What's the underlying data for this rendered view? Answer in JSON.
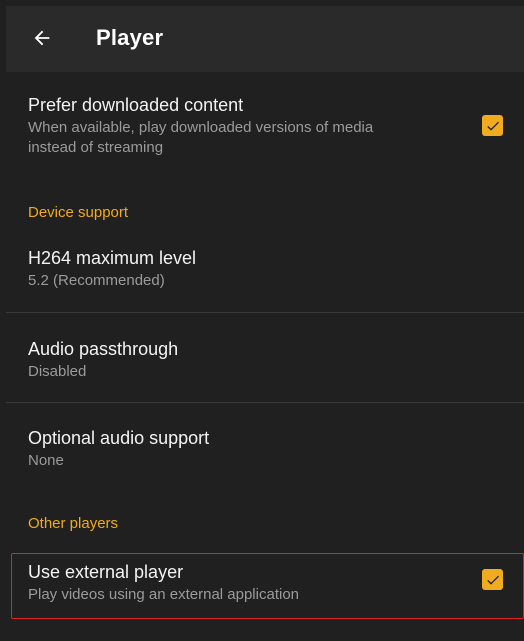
{
  "header": {
    "back_icon": "arrow-left-icon",
    "title": "Player"
  },
  "settings": {
    "prefer_downloaded": {
      "title": "Prefer downloaded content",
      "subtitle_line1": "When available, play downloaded versions of media",
      "subtitle_line2": "instead of streaming",
      "checked": true
    },
    "device_support_header": "Device support",
    "h264": {
      "title": "H264 maximum level",
      "value": "5.2 (Recommended)"
    },
    "audio_passthrough": {
      "title": "Audio passthrough",
      "value": "Disabled"
    },
    "optional_audio": {
      "title": "Optional audio support",
      "value": "None"
    },
    "other_players_header": "Other players",
    "external_player": {
      "title": "Use external player",
      "subtitle": "Play videos using an external application",
      "checked": true
    }
  },
  "colors": {
    "accent": "#f0ab1e",
    "background": "#202020",
    "appbar": "#2a2a2a",
    "highlight_border": "#e02222"
  }
}
